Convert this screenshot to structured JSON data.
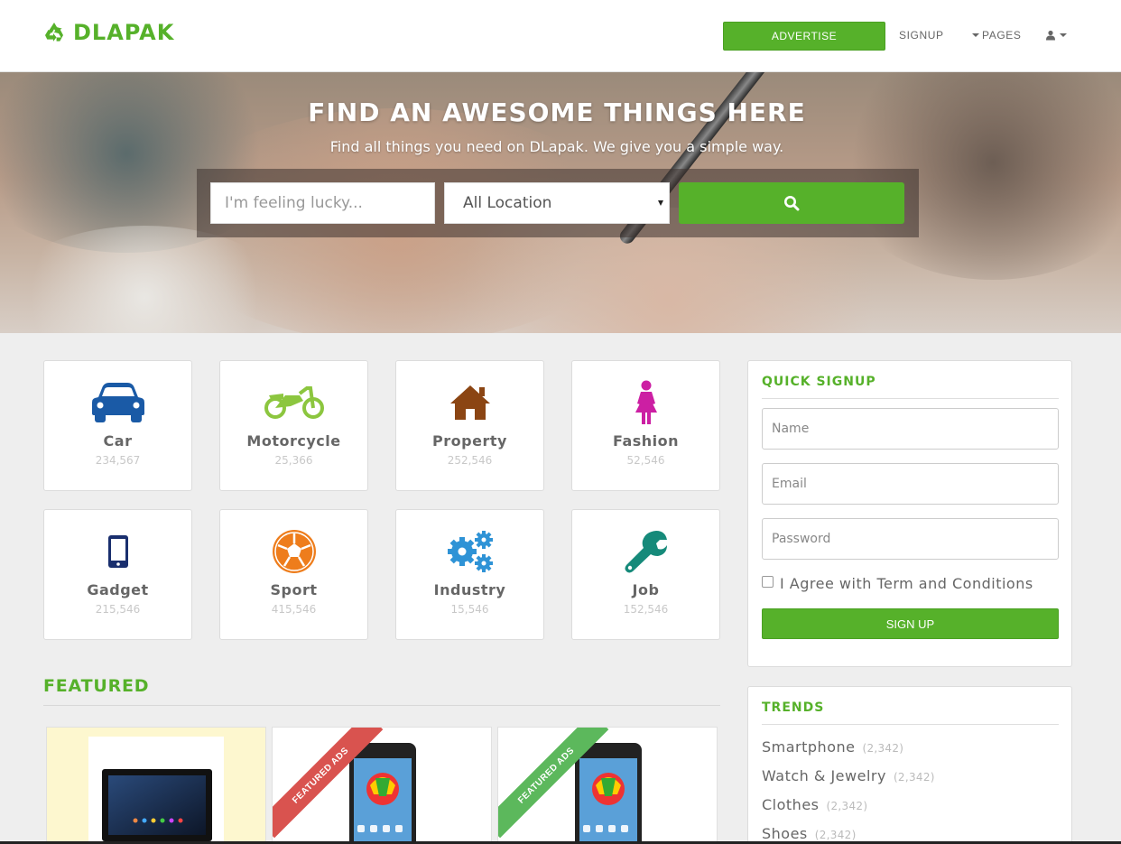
{
  "brand": {
    "name": "DLAPAK",
    "icon": "recycle-icon",
    "color": "#56b12a"
  },
  "nav": {
    "advertise": "ADVERTISE",
    "signup": "SIGNUP",
    "pages": "PAGES",
    "user_icon": "user-icon"
  },
  "hero": {
    "title": "FIND AN AWESOME THINGS HERE",
    "subtitle": "Find all things you need on DLapak. We give you a simple way.",
    "search_placeholder": "I'm feeling lucky...",
    "location": "All Location",
    "search_icon": "search-icon"
  },
  "categories": [
    {
      "name": "Car",
      "count": "234,567",
      "icon": "car-icon",
      "color": "#1a5aa6"
    },
    {
      "name": "Motorcycle",
      "count": "25,366",
      "icon": "motorcycle-icon",
      "color": "#8cc63f"
    },
    {
      "name": "Property",
      "count": "252,546",
      "icon": "home-icon",
      "color": "#8b4513"
    },
    {
      "name": "Fashion",
      "count": "52,546",
      "icon": "female-icon",
      "color": "#cc1fa3"
    },
    {
      "name": "Gadget",
      "count": "215,546",
      "icon": "mobile-icon",
      "color": "#1a2f6e"
    },
    {
      "name": "Sport",
      "count": "415,546",
      "icon": "soccer-ball-icon",
      "color": "#ee7d1c"
    },
    {
      "name": "Industry",
      "count": "15,546",
      "icon": "gears-icon",
      "color": "#2f93d6"
    },
    {
      "name": "Job",
      "count": "152,546",
      "icon": "wrench-icon",
      "color": "#168a7a"
    }
  ],
  "featured": {
    "title": "FEATURED",
    "cards": [
      {
        "ribbon": "",
        "ribbon_color": "",
        "bg": "#fdf7cf"
      },
      {
        "ribbon": "FEATURED ADS",
        "ribbon_color": "#d9534f",
        "bg": "#ffffff"
      },
      {
        "ribbon": "FEATURED ADS",
        "ribbon_color": "#5cb85c",
        "bg": "#ffffff"
      }
    ]
  },
  "quick_signup": {
    "title": "QUICK SIGNUP",
    "name_placeholder": "Name",
    "email_placeholder": "Email",
    "password_placeholder": "Password",
    "agree": "I Agree with Term and Conditions",
    "button": "SIGN UP"
  },
  "trends": {
    "title": "TRENDS",
    "items": [
      {
        "label": "Smartphone",
        "count": "(2,342)"
      },
      {
        "label": "Watch & Jewelry",
        "count": "(2,342)"
      },
      {
        "label": "Clothes",
        "count": "(2,342)"
      },
      {
        "label": "Shoes",
        "count": "(2,342)"
      }
    ]
  }
}
